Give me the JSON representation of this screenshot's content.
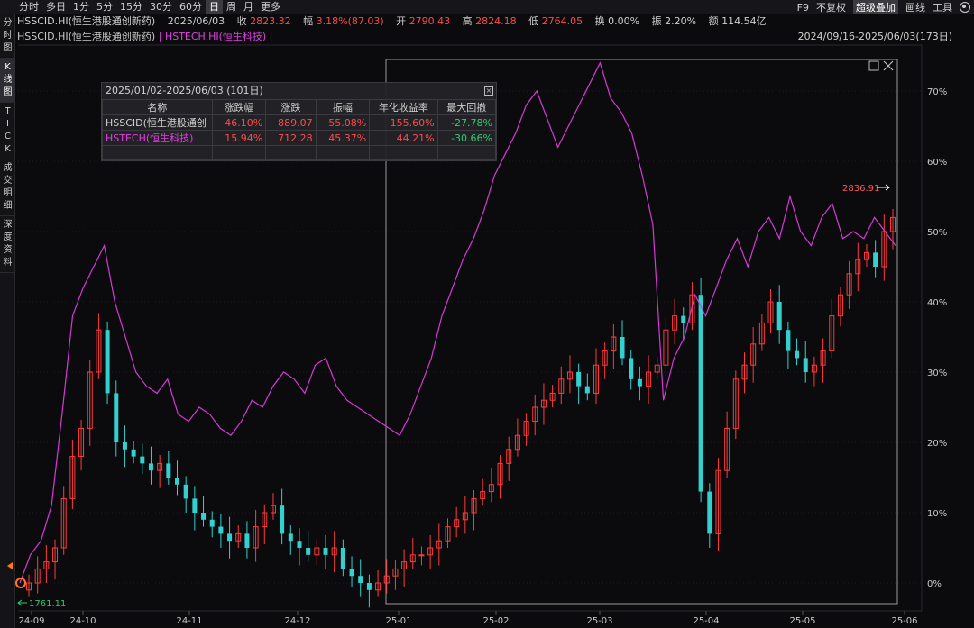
{
  "toolbar": {
    "periods": [
      "分时",
      "多日",
      "1分",
      "5分",
      "15分",
      "30分",
      "60分",
      "日",
      "周",
      "月",
      "更多"
    ],
    "active_period": "日",
    "right": [
      "F9",
      "不复权",
      "超级叠加",
      "画线",
      "工具"
    ],
    "active_right": "超级叠加"
  },
  "left_tabs": [
    {
      "label": "分时图",
      "chars": [
        "分",
        "时",
        "图"
      ]
    },
    {
      "label": "K线图",
      "chars": [
        "K",
        "线",
        "图"
      ]
    },
    {
      "label": "TICK",
      "chars": [
        "T",
        "I",
        "C",
        "K"
      ]
    },
    {
      "label": "成交明细",
      "chars": [
        "成",
        "交",
        "明",
        "细"
      ]
    },
    {
      "label": "深度资料",
      "chars": [
        "深",
        "度",
        "资",
        "料"
      ]
    }
  ],
  "quote": {
    "symbol": "HSSCID.HI(恒生港股通创新药)",
    "date": "2025/06/03",
    "close_label": "收",
    "close": "2823.32",
    "change_label": "幅",
    "change": "3.18%(87.03)",
    "open_label": "开",
    "open": "2790.43",
    "high_label": "高",
    "high": "2824.18",
    "low_label": "低",
    "low": "2764.05",
    "turnover_label": "换",
    "turnover": "0.00%",
    "amplitude_label": "振",
    "amplitude": "2.20%",
    "amount_label": "额",
    "amount": "114.54亿"
  },
  "legend": {
    "series1": "HSSCID.HI(恒生港股通创新药)",
    "sep": " | ",
    "series2": "HSTECH.HI(恒生科技)",
    "tail": " |"
  },
  "range_label": "2024/09/16-2025/06/03(173日)",
  "stats": {
    "header": "2025/01/02-2025/06/03 (101日)",
    "columns": [
      "名称",
      "涨跌幅",
      "涨跌",
      "振幅",
      "年化收益率",
      "最大回撤"
    ],
    "rows": [
      {
        "name": "HSSCID(恒生港股通创",
        "pct": "46.10%",
        "chg": "889.07",
        "amp": "55.08%",
        "annual": "155.60%",
        "dd": "-27.78%"
      },
      {
        "name": "HSTECH(恒生科技)",
        "pct": "15.94%",
        "chg": "712.28",
        "amp": "45.37%",
        "annual": "44.21%",
        "dd": "-30.66%"
      }
    ]
  },
  "annotations": {
    "high_label": "2836.91",
    "low_label": "1761.11"
  },
  "colors": {
    "up": "#ff3b3b",
    "down": "#33d0d0",
    "overlay": "#d63ad6",
    "background": "#0b0b0d",
    "grid": "#1e1e22"
  },
  "chart_data": {
    "type": "line",
    "y_axis": {
      "ticks": [
        "70%",
        "60%",
        "50%",
        "40%",
        "30%",
        "20%",
        "10%",
        "0%"
      ],
      "values": [
        70,
        60,
        50,
        40,
        30,
        20,
        10,
        0
      ]
    },
    "x_axis": {
      "ticks": [
        "24-09",
        "24-10",
        "24-11",
        "24-12",
        "25-01",
        "25-02",
        "25-03",
        "25-04",
        "25-05",
        "25-06"
      ]
    },
    "series": [
      {
        "name": "HSSCID.HI(恒生港股通创新药)",
        "style": "candlestick",
        "values_pct": [
          0,
          2,
          3,
          5,
          12,
          18,
          22,
          30,
          36,
          27,
          20,
          19,
          18,
          17,
          16,
          17,
          15,
          14,
          12,
          10,
          9,
          8,
          7,
          6,
          7,
          5,
          8,
          10,
          11,
          7,
          6,
          5,
          4,
          5,
          4,
          5,
          2,
          1,
          0,
          -1,
          0,
          1,
          2,
          3,
          4,
          4,
          5,
          6,
          8,
          9,
          10,
          12,
          13,
          14,
          17,
          19,
          21,
          23,
          25,
          26,
          27,
          29,
          30,
          28,
          27,
          31,
          33,
          35,
          32,
          29,
          28,
          30,
          31,
          36,
          38,
          37,
          41,
          13,
          7,
          16,
          22,
          29,
          31,
          34,
          37,
          40,
          36,
          33,
          32,
          30,
          31,
          33,
          38,
          41,
          44,
          46,
          47,
          45,
          50,
          52
        ]
      },
      {
        "name": "HSTECH.HI(恒生科技)",
        "style": "line",
        "values_pct": [
          0,
          4,
          6,
          11,
          24,
          38,
          42,
          45,
          48,
          40,
          35,
          30,
          28,
          27,
          29,
          24,
          23,
          25,
          24,
          22,
          21,
          23,
          26,
          25,
          28,
          30,
          29,
          27,
          31,
          32,
          28,
          26,
          25,
          24,
          23,
          22,
          21,
          24,
          28,
          32,
          38,
          42,
          46,
          49,
          53,
          58,
          61,
          64,
          68,
          70,
          66,
          62,
          65,
          68,
          71,
          74,
          69,
          67,
          64,
          58,
          51,
          26,
          32,
          35,
          41,
          38,
          42,
          46,
          49,
          45,
          50,
          52,
          49,
          55,
          50,
          48,
          52,
          54,
          49,
          50,
          49,
          52,
          50,
          48
        ]
      }
    ],
    "grid": true
  }
}
